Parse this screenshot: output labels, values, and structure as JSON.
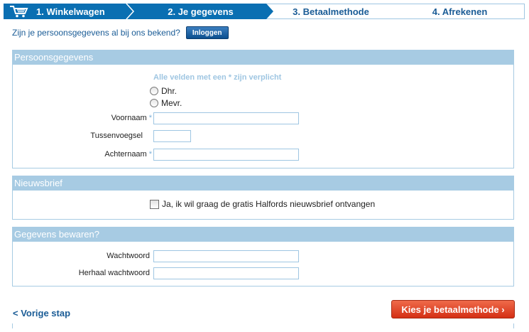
{
  "steps": [
    {
      "label": "1. Winkelwagen",
      "state": "done",
      "icon": "cart-icon"
    },
    {
      "label": "2. Je gegevens",
      "state": "current"
    },
    {
      "label": "3. Betaalmethode",
      "state": "todo"
    },
    {
      "label": "4. Afrekenen",
      "state": "todo"
    }
  ],
  "login": {
    "prompt": "Zijn je persoonsgegevens al bij ons bekend?",
    "button": "Inloggen"
  },
  "personal": {
    "title": "Persoonsgegevens",
    "required_note": "Alle velden met een * zijn verplicht",
    "salutation_options": [
      "Dhr.",
      "Mevr."
    ],
    "fields": {
      "first_name": {
        "label": "Voornaam",
        "required": "*",
        "value": ""
      },
      "infix": {
        "label": "Tussenvoegsel",
        "value": ""
      },
      "last_name": {
        "label": "Achternaam",
        "required": "*",
        "value": ""
      }
    }
  },
  "newsletter": {
    "title": "Nieuwsbrief",
    "checkbox_label": "Ja, ik wil graag de gratis Halfords nieuwsbrief ontvangen",
    "checked": false
  },
  "save": {
    "title": "Gegevens bewaren?",
    "fields": {
      "password": {
        "label": "Wachtwoord",
        "value": ""
      },
      "password_repeat": {
        "label": "Herhaal wachtwoord",
        "value": ""
      }
    }
  },
  "nav": {
    "prev": "< Vorige stap",
    "next": "Kies je betaalmethode ›"
  },
  "colors": {
    "primary": "#0a6fb2",
    "section_header": "#a7cbe3",
    "cta": "#d42f14"
  }
}
